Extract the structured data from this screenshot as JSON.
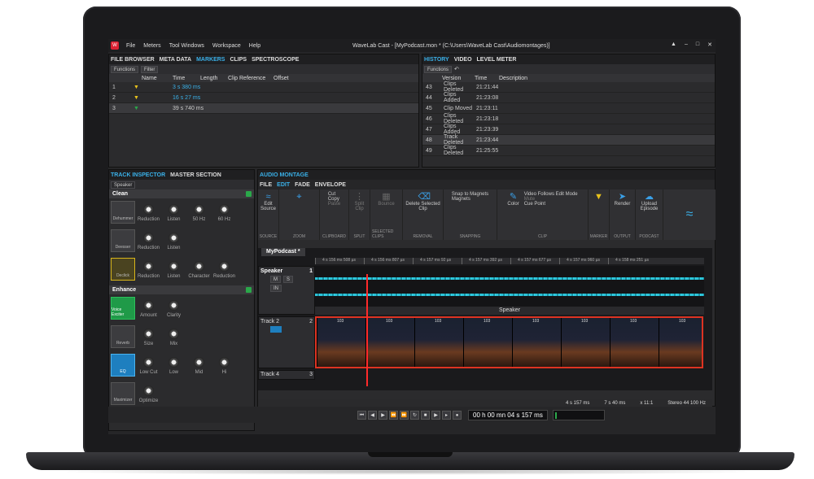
{
  "window": {
    "title": "WaveLab Cast - [MyPodcast.mon * (C:\\Users\\WaveLab Cast\\Audiomontages)]",
    "menu": [
      "File",
      "Meters",
      "Tool Windows",
      "Workspace",
      "Help"
    ],
    "buttons": [
      "▲",
      "–",
      "□",
      "✕"
    ]
  },
  "top_left": {
    "tabs": [
      "FILE BROWSER",
      "META DATA",
      "MARKERS",
      "CLIPS",
      "SPECTROSCOPE"
    ],
    "toolbar": [
      "Functions",
      "Filter"
    ],
    "columns": [
      "Name",
      "Time",
      "Length",
      "Clip Reference",
      "Offset"
    ],
    "rows": [
      {
        "idx": "1",
        "time": "3 s 380 ms"
      },
      {
        "idx": "2",
        "time": "16 s 27 ms"
      },
      {
        "idx": "3",
        "time": "39 s 740 ms"
      }
    ]
  },
  "top_right": {
    "tabs": [
      "HISTORY",
      "VIDEO",
      "LEVEL METER"
    ],
    "toolbar": [
      "Functions"
    ],
    "columns": [
      "Version",
      "Time",
      "Description"
    ],
    "rows": [
      {
        "v": "43",
        "d": "Clips Deleted",
        "t": "21:21:44"
      },
      {
        "v": "44",
        "d": "Clips Added",
        "t": "21:23:08"
      },
      {
        "v": "45",
        "d": "Clip Moved",
        "t": "21:23:11"
      },
      {
        "v": "46",
        "d": "Clips Deleted",
        "t": "21:23:18"
      },
      {
        "v": "47",
        "d": "Clips Added",
        "t": "21:23:39"
      },
      {
        "v": "48",
        "d": "Track Deleted",
        "t": "21:23:44"
      },
      {
        "v": "49",
        "d": "Clips Deleted",
        "t": "21:25:55"
      }
    ]
  },
  "inspector": {
    "tabs": [
      "TRACK INSPECTOR",
      "MASTER SECTION"
    ],
    "track": "Speaker",
    "clean": {
      "title": "Clean",
      "rows": [
        {
          "module": "Dehummer",
          "knobs": [
            "Reduction",
            "Listen",
            "50 Hz",
            "60 Hz"
          ]
        },
        {
          "module": "Deesser",
          "knobs": [
            "Reduction",
            "Listen"
          ]
        },
        {
          "module": "Declick",
          "knobs": [
            "Reduction",
            "Listen",
            "Character",
            "Reduction"
          ]
        }
      ]
    },
    "enhance": {
      "title": "Enhance",
      "rows": [
        {
          "module": "Voice Exciter",
          "knobs": [
            "Amount",
            "Clarity"
          ]
        },
        {
          "module": "Reverb",
          "knobs": [
            "Size",
            "Mix"
          ]
        },
        {
          "module": "EQ",
          "knobs": [
            "Low Cut",
            "Low",
            "Mid",
            "Hi"
          ]
        },
        {
          "module": "Maximizer",
          "knobs": [
            "Optimize"
          ]
        }
      ]
    }
  },
  "montage": {
    "tab": "AUDIO MONTAGE",
    "subtabs": [
      "FILE",
      "EDIT",
      "FADE",
      "ENVELOPE"
    ],
    "ribbon": {
      "source": {
        "label": "Edit Source",
        "group": "SOURCE"
      },
      "zoom": {
        "group": "ZOOM"
      },
      "clipboard": {
        "items": [
          "Cut",
          "Copy",
          "Paste"
        ],
        "group": "CLIPBOARD"
      },
      "split": {
        "label": "Split Clip",
        "group": "SPLIT"
      },
      "selected": {
        "label": "Bounce",
        "group": "SELECTED CLIPS"
      },
      "removal": {
        "label": "Delete Selected Clip",
        "group": "REMOVAL"
      },
      "snapping": {
        "items": [
          "Snap to Magnets",
          "Magnets"
        ],
        "group": "SNAPPING"
      },
      "clip": {
        "items": [
          "Video Follows Edit Mode",
          "Mute",
          "Cue Point"
        ],
        "color": "Color",
        "group": "CLIP"
      },
      "marker": {
        "group": "MARKER"
      },
      "output": {
        "label": "Render",
        "group": "OUTPUT"
      },
      "podcast": {
        "label": "Upload Episode",
        "group": "PODCAST"
      }
    },
    "doc_tab": "MyPodcast *",
    "ruler": [
      "4 s 156 ms 508 µs",
      "4 s 156 ms 807 µs",
      "4 s 157 ms 92 µs",
      "4 s 157 ms 392 µs",
      "4 s 157 ms 677 µs",
      "4 s 157 ms 960 µs",
      "4 s 158 ms 251 µs"
    ],
    "tracks": [
      {
        "name": "Speaker",
        "num": "1",
        "clip": "Speaker"
      },
      {
        "name": "Track 2",
        "num": "2",
        "frames": [
          "103",
          "103",
          "103",
          "103",
          "103",
          "103",
          "103",
          "103"
        ]
      },
      {
        "name": "Track 4",
        "num": "3"
      }
    ],
    "track_buttons": [
      "M",
      "S",
      "IN"
    ],
    "status": [
      "4 s 157 ms",
      "7 s 40 ms",
      "x 11:1",
      "Stereo 44 100 Hz"
    ]
  },
  "transport": {
    "time": "00 h 00 mn 04 s 157 ms"
  },
  "colors": {
    "accent": "#3ab0e8",
    "record": "#ff2a2a",
    "wave": "#2bc3d8",
    "power": "#2aa84a"
  }
}
